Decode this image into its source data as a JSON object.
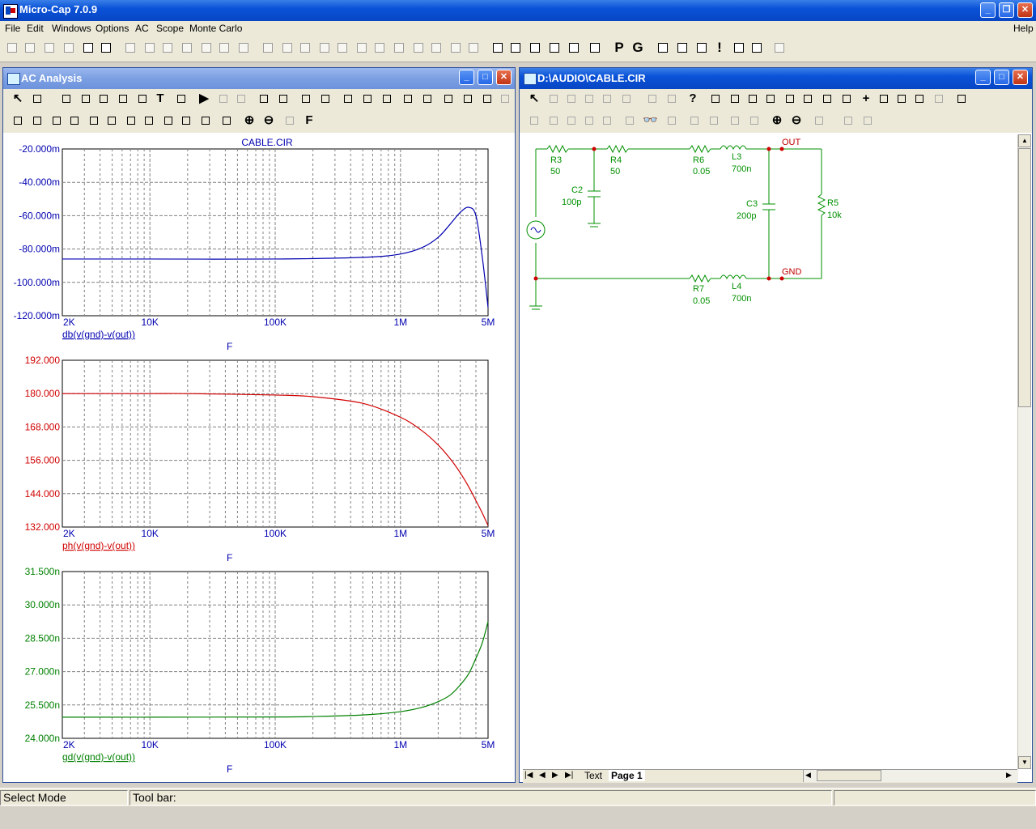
{
  "app": {
    "title": "Micro-Cap 7.0.9",
    "menu": [
      "File",
      "Edit",
      "Windows",
      "Options",
      "AC",
      "Scope",
      "Monte Carlo"
    ],
    "help_label": "Help"
  },
  "analysis_window": {
    "title": "AC Analysis",
    "plot_title": "CABLE.CIR",
    "x_axis_label": "F"
  },
  "schematic_window": {
    "title": "D:\\AUDIO\\CABLE.CIR",
    "tab_text": "Text",
    "tab_page": "Page 1",
    "components": [
      {
        "ref": "R3",
        "value": "50"
      },
      {
        "ref": "R4",
        "value": "50"
      },
      {
        "ref": "C2",
        "value": "100p"
      },
      {
        "ref": "R6",
        "value": "0.05"
      },
      {
        "ref": "L3",
        "value": "700n"
      },
      {
        "ref": "C3",
        "value": "200p"
      },
      {
        "ref": "R5",
        "value": "10k"
      },
      {
        "ref": "R7",
        "value": "0.05"
      },
      {
        "ref": "L4",
        "value": "700n"
      }
    ],
    "nodes": [
      "OUT",
      "GND"
    ]
  },
  "status": {
    "mode": "Select Mode",
    "toolbar_hint": "Tool bar:"
  },
  "chart_data": [
    {
      "type": "line",
      "title": "CABLE.CIR",
      "xlabel": "F",
      "x_scale": "log",
      "xlim": [
        2000,
        5000000
      ],
      "x_tick_labels": [
        "2K",
        "10K",
        "100K",
        "1M",
        "5M"
      ],
      "ylim": [
        -120,
        -20
      ],
      "y_tick_labels": [
        "-20.000m",
        "-40.000m",
        "-60.000m",
        "-80.000m",
        "-100.000m",
        "-120.000m"
      ],
      "series": [
        {
          "name": "db(v(gnd)-v(out))",
          "color": "#0000b0",
          "x": [
            2000,
            10000,
            100000,
            500000,
            1000000,
            1500000,
            2000000,
            2500000,
            3000000,
            3500000,
            4000000,
            4500000,
            5000000
          ],
          "y": [
            -86,
            -86,
            -86,
            -85,
            -83,
            -79,
            -73,
            -65,
            -58,
            -55,
            -60,
            -85,
            -115
          ]
        }
      ],
      "grid": true
    },
    {
      "type": "line",
      "xlabel": "F",
      "x_scale": "log",
      "xlim": [
        2000,
        5000000
      ],
      "x_tick_labels": [
        "2K",
        "10K",
        "100K",
        "1M",
        "5M"
      ],
      "ylim": [
        132,
        192
      ],
      "y_tick_labels": [
        "192.000",
        "180.000",
        "168.000",
        "156.000",
        "144.000",
        "132.000"
      ],
      "series": [
        {
          "name": "ph(v(gnd)-v(out))",
          "color": "#d00000",
          "x": [
            2000,
            10000,
            20000,
            100000,
            200000,
            500000,
            1000000,
            1500000,
            2000000,
            2500000,
            3000000,
            3500000,
            4000000,
            4500000,
            5000000
          ],
          "y": [
            180,
            180,
            180,
            179.5,
            178.9,
            176.5,
            171.5,
            166.5,
            161.5,
            156.5,
            151.5,
            146.5,
            141.5,
            137,
            132.5
          ]
        }
      ],
      "grid": true
    },
    {
      "type": "line",
      "xlabel": "F",
      "x_scale": "log",
      "xlim": [
        2000,
        5000000
      ],
      "x_tick_labels": [
        "2K",
        "10K",
        "100K",
        "1M",
        "5M"
      ],
      "ylim": [
        24,
        31.5
      ],
      "y_tick_labels": [
        "31.500n",
        "30.000n",
        "28.500n",
        "27.000n",
        "25.500n",
        "24.000n"
      ],
      "series": [
        {
          "name": "gd(v(gnd)-v(out))",
          "color": "#008000",
          "x": [
            2000,
            10000,
            100000,
            200000,
            500000,
            1000000,
            1500000,
            2000000,
            2500000,
            3000000,
            3500000,
            4000000,
            4500000,
            5000000
          ],
          "y": [
            24.95,
            24.95,
            24.96,
            24.98,
            25.05,
            25.2,
            25.4,
            25.65,
            25.95,
            26.4,
            26.9,
            27.6,
            28.3,
            29.25
          ]
        }
      ],
      "grid": true
    }
  ]
}
